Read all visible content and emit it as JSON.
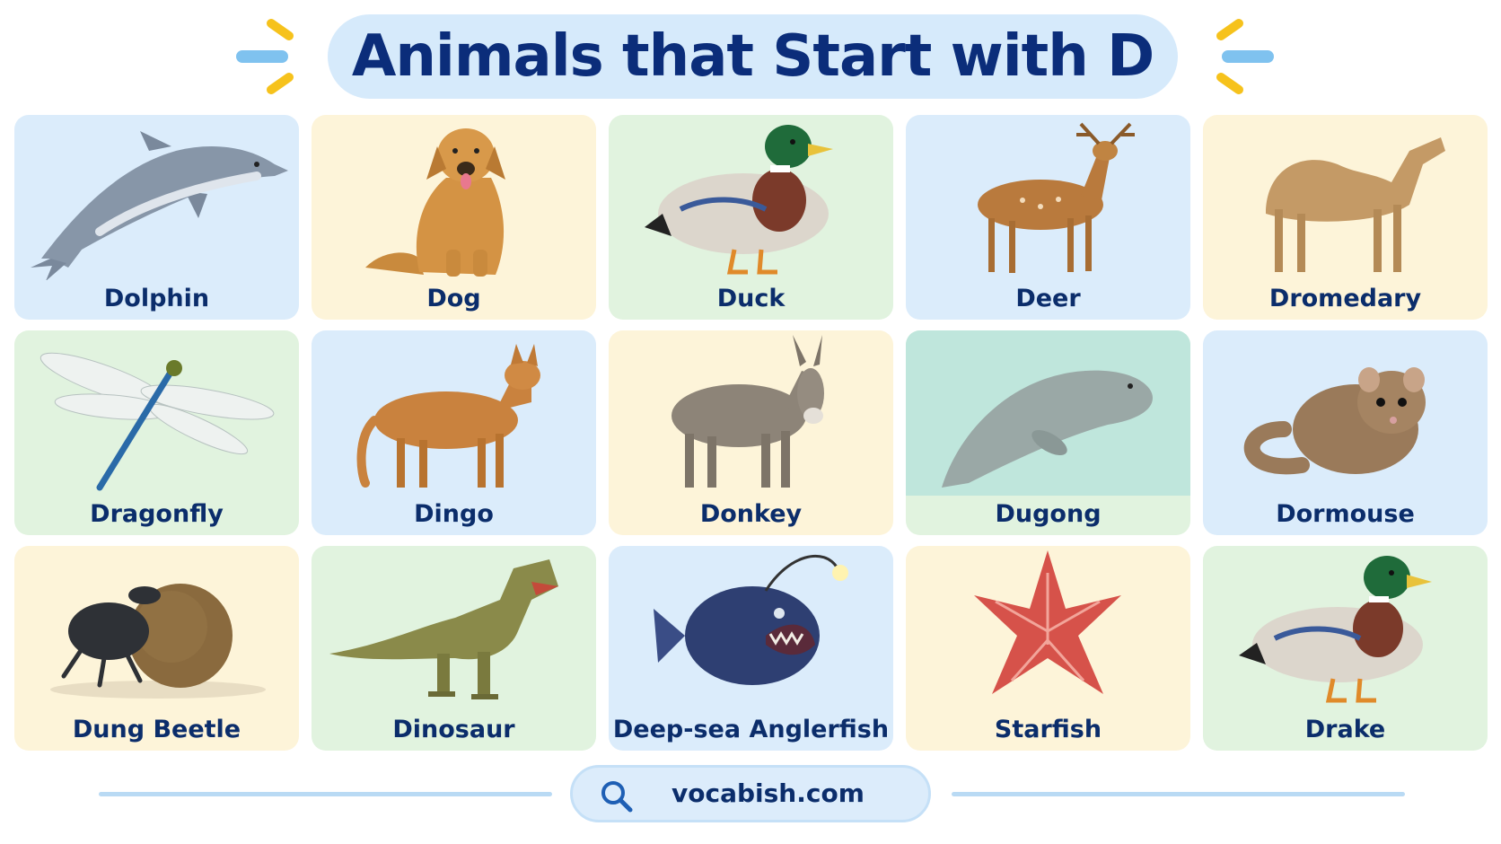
{
  "header": {
    "title": "Animals that Start with D"
  },
  "colors": {
    "title": "#0b2d7a",
    "label": "#0b2d6b",
    "card_blue": "#dbecfb",
    "card_yellow": "#fdf4d9",
    "card_green": "#e1f3df",
    "accent_yellow": "#f6c21c",
    "accent_blue": "#7fc2ef"
  },
  "cards": [
    {
      "label": "Dolphin",
      "bg": "blue",
      "icon": "dolphin-image"
    },
    {
      "label": "Dog",
      "bg": "yellow",
      "icon": "dog-image"
    },
    {
      "label": "Duck",
      "bg": "green",
      "icon": "duck-image"
    },
    {
      "label": "Deer",
      "bg": "blue",
      "icon": "deer-image"
    },
    {
      "label": "Dromedary",
      "bg": "yellow",
      "icon": "dromedary-image"
    },
    {
      "label": "Dragonfly",
      "bg": "green",
      "icon": "dragonfly-image"
    },
    {
      "label": "Dingo",
      "bg": "blue",
      "icon": "dingo-image"
    },
    {
      "label": "Donkey",
      "bg": "yellow",
      "icon": "donkey-image"
    },
    {
      "label": "Dugong",
      "bg": "green",
      "icon": "dugong-image"
    },
    {
      "label": "Dormouse",
      "bg": "blue",
      "icon": "dormouse-image"
    },
    {
      "label": "Dung Beetle",
      "bg": "yellow",
      "icon": "dung-beetle-image"
    },
    {
      "label": "Dinosaur",
      "bg": "green",
      "icon": "dinosaur-image"
    },
    {
      "label": "Deep-sea Anglerfish",
      "bg": "blue",
      "icon": "anglerfish-image"
    },
    {
      "label": "Starfish",
      "bg": "yellow",
      "icon": "starfish-image"
    },
    {
      "label": "Drake",
      "bg": "green",
      "icon": "drake-image"
    }
  ],
  "footer": {
    "site": "vocabish.com",
    "icon": "search-icon"
  }
}
